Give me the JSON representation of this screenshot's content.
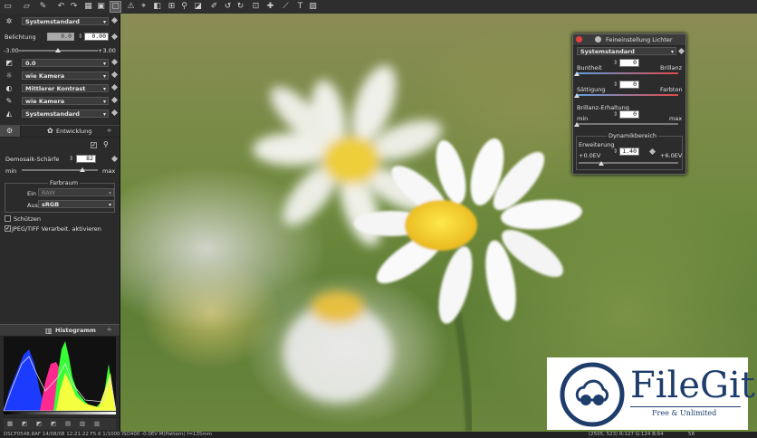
{
  "toolbar": {
    "icons": [
      "folder-open-icon",
      "folder-save-icon",
      "edit-icon",
      "grid-small-icon",
      "undo-icon",
      "redo-icon",
      "grid-icon",
      "grid-large-icon",
      "view-single-icon",
      "warning-icon",
      "crosshair-icon",
      "compare-icon",
      "grid-split-icon",
      "picker-icon",
      "wb-picker-icon",
      "rotate-left-icon",
      "rotate-right-icon",
      "flip-icon",
      "crop-icon",
      "straighten-icon",
      "picker-plus-icon",
      "brush-icon",
      "text-icon",
      "image-icon"
    ]
  },
  "left_panel": {
    "white_balance": {
      "value": "Systemstandard"
    },
    "exposure": {
      "label": "Belichtung",
      "value1": "0.0",
      "value2": "0.00",
      "min": "-3.00",
      "max": "+3.00",
      "level": 0.5
    },
    "rows": [
      {
        "icon": "vignette-icon",
        "value": "0.0"
      },
      {
        "icon": "sun-icon",
        "value": "wie Kamera"
      },
      {
        "icon": "contrast-icon",
        "value": "Mittlerer Kontrast"
      },
      {
        "icon": "brush-icon",
        "value": "wie Kamera"
      },
      {
        "icon": "mountain-icon",
        "value": "Systemstandard"
      }
    ],
    "development": {
      "title": "Entwicklung",
      "demosaic_label": "Demosaik-Schärfe",
      "demosaic_value": "82",
      "min": "min",
      "max": "max",
      "level": 0.8,
      "colorspace_title": "Farbraum",
      "in_label": "Ein",
      "in_value": "RAW",
      "out_label": "Aus",
      "out_value": "sRGB",
      "protect_label": "Schützen",
      "jpeg_label": "JPEG/TIFF Verarbeit. aktivieren"
    },
    "histogram": {
      "title": "Histogramm"
    }
  },
  "panel": {
    "title": "Feineinstellung Lichter",
    "preset": "Systemstandard",
    "brightness_label": "Buntheit",
    "brightness_value": "0",
    "brightness_right": "Brillanz",
    "brightness_level": 0.0,
    "saturation_label": "Sättigung",
    "saturation_value": "0",
    "saturation_right": "Farbton",
    "saturation_level": 0.0,
    "brilliance_label": "Brillanz-Erhaltung",
    "brilliance_value": "0",
    "brilliance_min": "min",
    "brilliance_max": "max",
    "brilliance_level": 0.0,
    "range_title": "Dynamikbereich",
    "extension_label": "Erweiterung",
    "extension_value": "1.40",
    "extension_min": "+0.0EV",
    "extension_max": "+6.0EV",
    "extension_level": 0.23
  },
  "statusbar": {
    "left": "DSCF0548.RAF 14/08/08 12:21:22 F5.6 1/1000 ISO400 -0.0EV M(Pattern) f=135mm",
    "right": "(2505, 523) R:127 G:124 B:64",
    "zoom": "58"
  },
  "watermark": {
    "brand": "FileGit",
    "tagline": "Free & Unlimited"
  }
}
